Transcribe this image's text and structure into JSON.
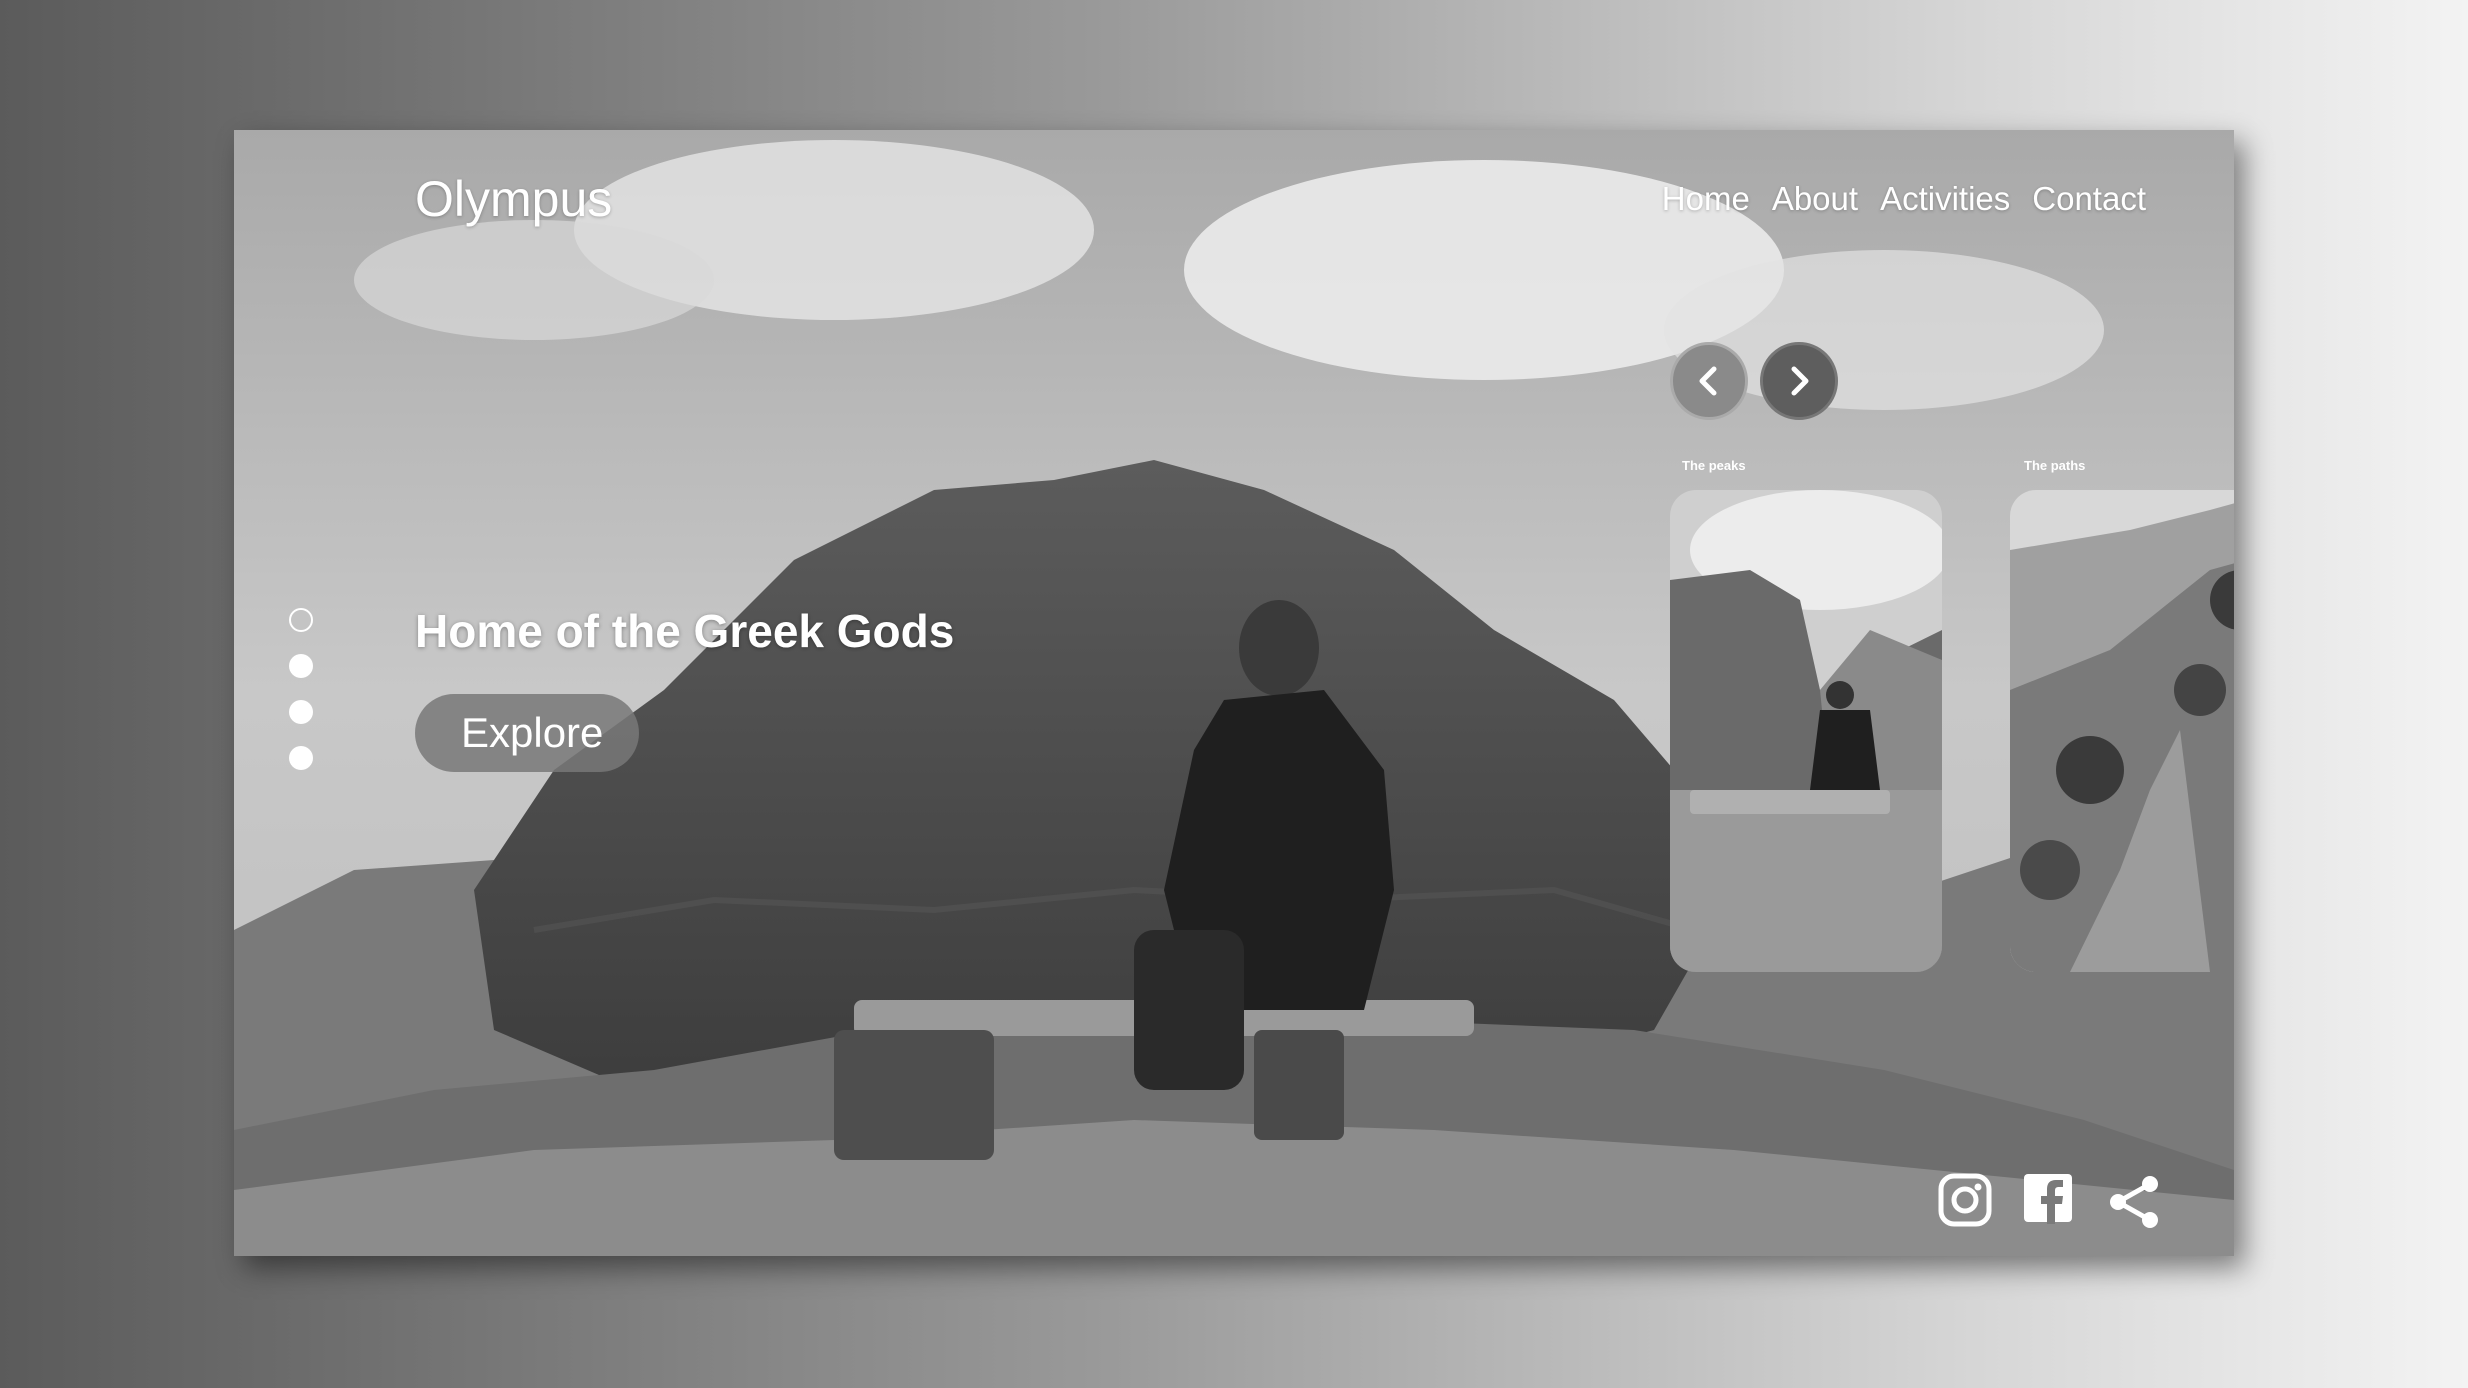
{
  "brand": {
    "name": "Olympus"
  },
  "nav": {
    "items": [
      "Home",
      "About",
      "Activities",
      "Contact"
    ]
  },
  "hero": {
    "headline": "Home of the Greek Gods",
    "cta_label": "Explore",
    "slide_count": 4,
    "active_slide": 1
  },
  "carousel": {
    "prev_icon": "chevron-left-icon",
    "next_icon": "chevron-right-icon",
    "cards": [
      {
        "label": "The peaks"
      },
      {
        "label": "The paths"
      }
    ]
  },
  "social": {
    "icons": [
      "instagram-icon",
      "facebook-icon",
      "share-icon"
    ]
  },
  "colors": {
    "text": "#ffffff",
    "button": "#787878",
    "arrow": "#6a6a6a"
  }
}
